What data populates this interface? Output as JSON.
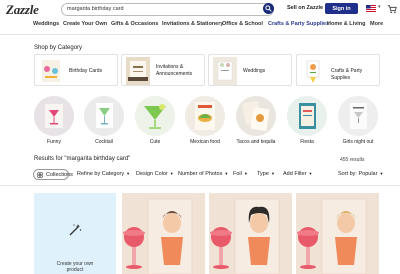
{
  "header": {
    "logo": "Zazzle",
    "search_value": "margarita birthday card",
    "sell_label": "Sell on Zazzle",
    "signin_label": "Sign in"
  },
  "nav": [
    "Weddings",
    "Create Your Own",
    "Gifts & Occasions",
    "Invitations & Stationery",
    "Office & School",
    "Crafts & Party Supplies",
    "Home & Living",
    "More"
  ],
  "shop_by_category": {
    "title": "Shop by Category",
    "cards": [
      {
        "label": "Birthday Cards"
      },
      {
        "label": "Invitations &\nAnnouncements"
      },
      {
        "label": "Weddings"
      },
      {
        "label": "Crafts & Party Supplies"
      }
    ]
  },
  "themes": [
    {
      "label": "Funny"
    },
    {
      "label": "Cocktail"
    },
    {
      "label": "Cute"
    },
    {
      "label": "Mexican food"
    },
    {
      "label": "Tacos and tequila"
    },
    {
      "label": "Fiesta"
    },
    {
      "label": "Girls night out"
    }
  ],
  "results": {
    "title": "Results for \"margarita birthday card\"",
    "count": "455 results"
  },
  "filters": {
    "collections": "Collections",
    "refine": "Refine by Category",
    "design_color": "Design Color",
    "photos": "Number of Photos",
    "foil": "Foil",
    "type": "Type",
    "add_filter": "Add Filter",
    "sort_label": "Sort by:",
    "sort_value": "Popular"
  },
  "create_tile": {
    "text": "Create your own\nproduct"
  },
  "colors": {
    "brand_navy": "#1f2f8a",
    "create_bg": "#dff2fb"
  }
}
